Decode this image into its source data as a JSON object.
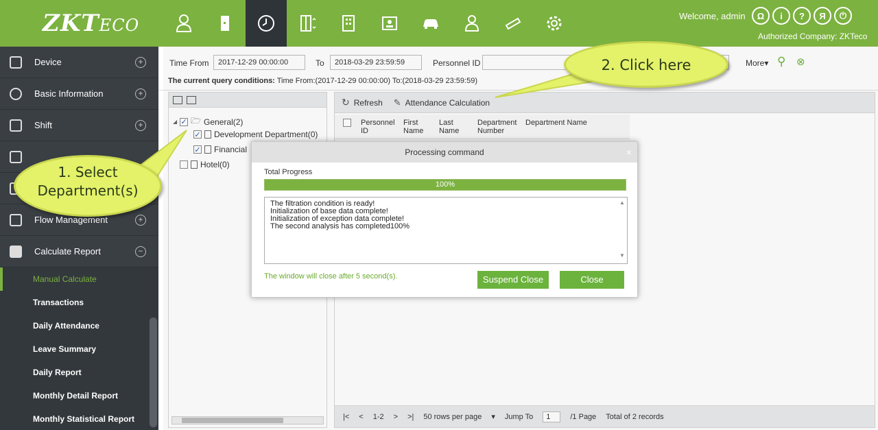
{
  "topbar": {
    "logo_main": "ZKT",
    "logo_sub": "ECO",
    "welcome": "Welcome, admin",
    "company": "Authorized Company: ZKTeco",
    "nav_icons": [
      "personnel-icon",
      "access-icon",
      "attendance-clock-icon",
      "elevator-icon",
      "building-icon",
      "visitor-icon",
      "parking-car-icon",
      "patrol-icon",
      "video-icon",
      "system-gear-icon"
    ],
    "header_buttons": [
      "Ω",
      "i",
      "?",
      "Я",
      "⏻"
    ]
  },
  "sidebar": {
    "items": [
      {
        "label": "Device"
      },
      {
        "label": "Basic Information"
      },
      {
        "label": "Shift"
      },
      {
        "label": ""
      },
      {
        "label": ""
      },
      {
        "label": "Flow Management"
      },
      {
        "label": "Calculate Report"
      }
    ],
    "subitems": [
      {
        "label": "Manual Calculate"
      },
      {
        "label": "Transactions"
      },
      {
        "label": "Daily Attendance"
      },
      {
        "label": "Leave Summary"
      },
      {
        "label": "Daily Report"
      },
      {
        "label": "Monthly Detail Report"
      },
      {
        "label": "Monthly Statistical Report"
      }
    ]
  },
  "query": {
    "time_from_label": "Time From",
    "time_from_value": "2017-12-29 00:00:00",
    "to_label": "To",
    "to_value": "2018-03-29 23:59:59",
    "personnel_id_label": "Personnel ID",
    "more_label": "More▾",
    "conditions_label": "The current query conditions:",
    "conditions_value": "Time From:(2017-12-29 00:00:00)  To:(2018-03-29 23:59:59)"
  },
  "tree": {
    "root": "General(2)",
    "children": [
      "Development Department(0)",
      "Financial",
      "Hotel(0)"
    ]
  },
  "toolbar": {
    "refresh": "Refresh",
    "attendance_calc": "Attendance Calculation"
  },
  "grid": {
    "headers": [
      "Personnel ID",
      "First Name",
      "Last Name",
      "Department Number",
      "Department Name"
    ]
  },
  "pager": {
    "pages": "1-2",
    "rows_per_page": "50 rows per page",
    "jump_label": "Jump To",
    "jump_value": "1",
    "page_total": "/1 Page",
    "records": "Total of 2 records"
  },
  "dialog": {
    "title": "Processing command",
    "progress_label": "Total Progress",
    "progress_value": 100,
    "progress_text": "100%",
    "log_lines": [
      "The filtration condition is ready!",
      "Initialization of base data complete!",
      "Initialization of exception data complete!",
      "The second analysis has completed100%"
    ],
    "note": "The window will close after 5 second(s).",
    "suspend_close": "Suspend Close",
    "close": "Close"
  },
  "callouts": {
    "step1": "1. Select Department(s)",
    "step2": "2. Click here"
  },
  "colors": {
    "brand_green": "#7cb240",
    "sidebar_dark": "#3a3f44",
    "callout_yellow": "#e4f26a"
  }
}
